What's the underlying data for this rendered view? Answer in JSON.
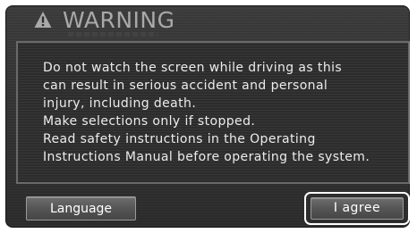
{
  "dialog": {
    "title": "WARNING",
    "icon": "warning-triangle-icon",
    "message_lines": [
      "Do not watch the screen while driving as this",
      "can result in serious accident and personal",
      "injury, including death.",
      "Make selections only if stopped.",
      "Read safety instructions in the Operating",
      "Instructions Manual before operating the system."
    ]
  },
  "buttons": {
    "language_label": "Language",
    "agree_label": "I agree"
  },
  "colors": {
    "panel_bg": "#2c2c2c",
    "title_text": "#a9a9a9",
    "body_text": "#ececec",
    "button_bg": "#5a5a5a",
    "focus_ring": "#ffffff"
  }
}
